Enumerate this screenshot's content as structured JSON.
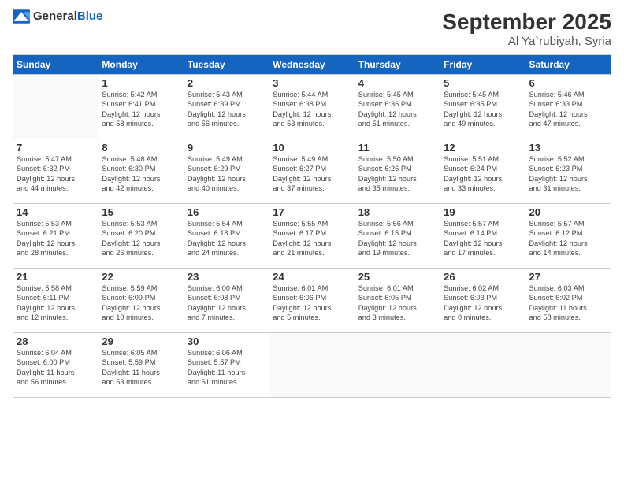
{
  "logo": {
    "general": "General",
    "blue": "Blue"
  },
  "header": {
    "month": "September 2025",
    "location": "Al Ya`rubiyah, Syria"
  },
  "weekdays": [
    "Sunday",
    "Monday",
    "Tuesday",
    "Wednesday",
    "Thursday",
    "Friday",
    "Saturday"
  ],
  "weeks": [
    [
      {
        "day": "",
        "detail": ""
      },
      {
        "day": "1",
        "detail": "Sunrise: 5:42 AM\nSunset: 6:41 PM\nDaylight: 12 hours\nand 58 minutes."
      },
      {
        "day": "2",
        "detail": "Sunrise: 5:43 AM\nSunset: 6:39 PM\nDaylight: 12 hours\nand 56 minutes."
      },
      {
        "day": "3",
        "detail": "Sunrise: 5:44 AM\nSunset: 6:38 PM\nDaylight: 12 hours\nand 53 minutes."
      },
      {
        "day": "4",
        "detail": "Sunrise: 5:45 AM\nSunset: 6:36 PM\nDaylight: 12 hours\nand 51 minutes."
      },
      {
        "day": "5",
        "detail": "Sunrise: 5:45 AM\nSunset: 6:35 PM\nDaylight: 12 hours\nand 49 minutes."
      },
      {
        "day": "6",
        "detail": "Sunrise: 5:46 AM\nSunset: 6:33 PM\nDaylight: 12 hours\nand 47 minutes."
      }
    ],
    [
      {
        "day": "7",
        "detail": "Sunrise: 5:47 AM\nSunset: 6:32 PM\nDaylight: 12 hours\nand 44 minutes."
      },
      {
        "day": "8",
        "detail": "Sunrise: 5:48 AM\nSunset: 6:30 PM\nDaylight: 12 hours\nand 42 minutes."
      },
      {
        "day": "9",
        "detail": "Sunrise: 5:49 AM\nSunset: 6:29 PM\nDaylight: 12 hours\nand 40 minutes."
      },
      {
        "day": "10",
        "detail": "Sunrise: 5:49 AM\nSunset: 6:27 PM\nDaylight: 12 hours\nand 37 minutes."
      },
      {
        "day": "11",
        "detail": "Sunrise: 5:50 AM\nSunset: 6:26 PM\nDaylight: 12 hours\nand 35 minutes."
      },
      {
        "day": "12",
        "detail": "Sunrise: 5:51 AM\nSunset: 6:24 PM\nDaylight: 12 hours\nand 33 minutes."
      },
      {
        "day": "13",
        "detail": "Sunrise: 5:52 AM\nSunset: 6:23 PM\nDaylight: 12 hours\nand 31 minutes."
      }
    ],
    [
      {
        "day": "14",
        "detail": "Sunrise: 5:53 AM\nSunset: 6:21 PM\nDaylight: 12 hours\nand 28 minutes."
      },
      {
        "day": "15",
        "detail": "Sunrise: 5:53 AM\nSunset: 6:20 PM\nDaylight: 12 hours\nand 26 minutes."
      },
      {
        "day": "16",
        "detail": "Sunrise: 5:54 AM\nSunset: 6:18 PM\nDaylight: 12 hours\nand 24 minutes."
      },
      {
        "day": "17",
        "detail": "Sunrise: 5:55 AM\nSunset: 6:17 PM\nDaylight: 12 hours\nand 21 minutes."
      },
      {
        "day": "18",
        "detail": "Sunrise: 5:56 AM\nSunset: 6:15 PM\nDaylight: 12 hours\nand 19 minutes."
      },
      {
        "day": "19",
        "detail": "Sunrise: 5:57 AM\nSunset: 6:14 PM\nDaylight: 12 hours\nand 17 minutes."
      },
      {
        "day": "20",
        "detail": "Sunrise: 5:57 AM\nSunset: 6:12 PM\nDaylight: 12 hours\nand 14 minutes."
      }
    ],
    [
      {
        "day": "21",
        "detail": "Sunrise: 5:58 AM\nSunset: 6:11 PM\nDaylight: 12 hours\nand 12 minutes."
      },
      {
        "day": "22",
        "detail": "Sunrise: 5:59 AM\nSunset: 6:09 PM\nDaylight: 12 hours\nand 10 minutes."
      },
      {
        "day": "23",
        "detail": "Sunrise: 6:00 AM\nSunset: 6:08 PM\nDaylight: 12 hours\nand 7 minutes."
      },
      {
        "day": "24",
        "detail": "Sunrise: 6:01 AM\nSunset: 6:06 PM\nDaylight: 12 hours\nand 5 minutes."
      },
      {
        "day": "25",
        "detail": "Sunrise: 6:01 AM\nSunset: 6:05 PM\nDaylight: 12 hours\nand 3 minutes."
      },
      {
        "day": "26",
        "detail": "Sunrise: 6:02 AM\nSunset: 6:03 PM\nDaylight: 12 hours\nand 0 minutes."
      },
      {
        "day": "27",
        "detail": "Sunrise: 6:03 AM\nSunset: 6:02 PM\nDaylight: 11 hours\nand 58 minutes."
      }
    ],
    [
      {
        "day": "28",
        "detail": "Sunrise: 6:04 AM\nSunset: 6:00 PM\nDaylight: 11 hours\nand 56 minutes."
      },
      {
        "day": "29",
        "detail": "Sunrise: 6:05 AM\nSunset: 5:59 PM\nDaylight: 11 hours\nand 53 minutes."
      },
      {
        "day": "30",
        "detail": "Sunrise: 6:06 AM\nSunset: 5:57 PM\nDaylight: 11 hours\nand 51 minutes."
      },
      {
        "day": "",
        "detail": ""
      },
      {
        "day": "",
        "detail": ""
      },
      {
        "day": "",
        "detail": ""
      },
      {
        "day": "",
        "detail": ""
      }
    ]
  ]
}
